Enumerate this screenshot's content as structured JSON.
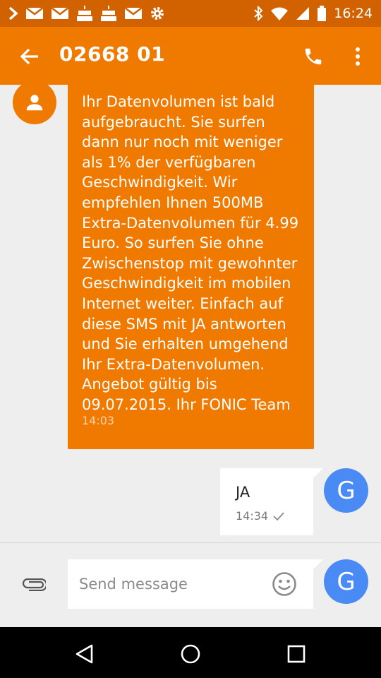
{
  "status_bar": {
    "time": "16:24",
    "left_icons": [
      "chevron-right-icon",
      "mail-icon",
      "mail-icon",
      "cake-icon",
      "cake-icon",
      "mail-icon",
      "gear-icon"
    ],
    "right_icons": [
      "bluetooth-icon",
      "wifi-icon",
      "signal-icon",
      "battery-icon"
    ]
  },
  "header": {
    "title": "02668 01",
    "back_icon": "arrow-left-icon",
    "call_icon": "phone-icon",
    "more_icon": "more-vert-icon"
  },
  "messages": [
    {
      "direction": "incoming",
      "text": "Ihr Datenvolumen ist bald\naufgebraucht. Sie surfen\ndann nur noch mit weniger\nals 1% der verfügbaren\nGeschwindigkeit. Wir\nempfehlen Ihnen 500MB\nExtra-Datenvolumen für 4.99\nEuro. So surfen Sie ohne\nZwischenstop mit gewohnter\nGeschwindigkeit im mobilen\nInternet weiter. Einfach auf\ndiese SMS mit JA antworten\nund Sie erhalten umgehend\nIhr Extra-Datenvolumen.\nAngebot gültig bis\n09.07.2015. Ihr FONIC Team",
      "time": "14:03"
    },
    {
      "direction": "outgoing",
      "text": "JA",
      "time": "14:34",
      "avatar_letter": "G"
    }
  ],
  "compose": {
    "placeholder": "Send message",
    "avatar_letter": "G"
  },
  "colors": {
    "status_bar": "#d26200",
    "app_bar": "#f07a00",
    "self_avatar": "#4a8af4",
    "background": "#eeeeee"
  }
}
